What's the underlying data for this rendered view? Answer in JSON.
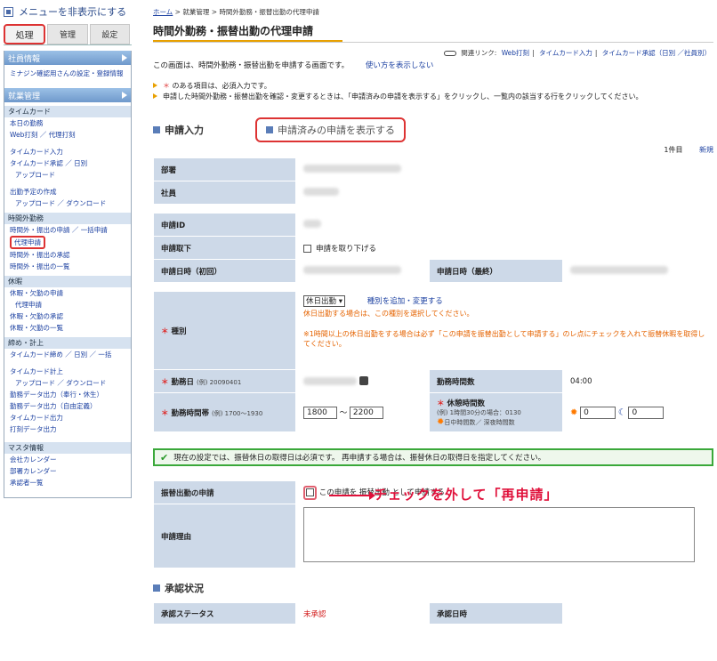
{
  "sidebar": {
    "hide_menu": "メニューを非表示にする",
    "tabs": [
      "処理",
      "管理",
      "設定"
    ],
    "sections": [
      {
        "title": "社員情報",
        "items": [
          "ミナジン確認用さんの設定・登録情報"
        ]
      },
      {
        "title": "就業管理"
      }
    ],
    "categories": {
      "timecard": "タイムカード",
      "overtime": "時間外勤務",
      "leave": "休暇",
      "close": "締め・計上",
      "master": "マスタ情報"
    },
    "timecard_items": [
      "本日の勤務",
      "Web打刻 ／ 代理打刻",
      "タイムカード入力",
      "タイムカード承認 ／ 日別",
      "アップロード",
      "出勤予定の作成",
      "アップロード ／ ダウンロード"
    ],
    "overtime_items": [
      "時間外・振出の申請 ／ 一括申請",
      "代理申請",
      "時間外・振出の承認",
      "時間外・振出の一覧"
    ],
    "leave_items": [
      "休暇・欠勤の申請",
      "代理申請",
      "休暇・欠勤の承認",
      "休暇・欠勤の一覧"
    ],
    "close_items": [
      "タイムカード締め ／ 日別 ／ 一括",
      "タイムカード計上",
      "アップロード ／ ダウンロード",
      "勤務データ出力（奉行・休生）",
      "勤務データ出力（自由定義）",
      "タイムカード出力",
      "打刻データ出力"
    ],
    "master_items": [
      "会社カレンダー",
      "部署カレンダー",
      "承認者一覧"
    ]
  },
  "breadcrumb": {
    "home": "ホーム",
    "sep": ">",
    "b2": "就業管理",
    "b3": "時間外勤務・振替出勤の代理申請"
  },
  "page_title": "時間外勤務・振替出勤の代理申請",
  "related": {
    "label": "関連リンク:",
    "links": [
      "Web打刻",
      "タイムカード入力",
      "タイムカード承認（日別 ／社員別）"
    ]
  },
  "description": "この画面は、時間外勤務・振替出勤を申請する画面です。",
  "how_to": "使い方を表示しない",
  "notes": [
    "のある項目は、必須入力です。",
    "申請した時間外勤務・振替出勤を確認・変更するときは、「申請済みの申請を表示する」をクリックし、一覧内の該当する行をクリックしてください。"
  ],
  "section_input": "申請入力",
  "show_submitted": "申請済みの申請を表示する",
  "count": "1件目",
  "new": "新規",
  "form": {
    "dept": "部署",
    "employee": "社員",
    "app_id": "申請ID",
    "withdraw": "申請取下",
    "withdraw_check": "申請を取り下げる",
    "date_first": "申請日時（初回）",
    "date_latest": "申請日時（最終）",
    "type": "種別",
    "type_value": "休日出勤",
    "type_link": "種別を追加・変更する",
    "type_note1": "休日出勤する場合は、この種別を選択してください。",
    "type_note2": "※1時間以上の休日出勤をする場合は必ず「この申請を振替出勤として申請する」のレ点にチェックを入れて振替休暇を取得してください。",
    "work_date": "勤務日",
    "work_date_ex": "(例) 20090401",
    "work_hours_label": "勤務時間数",
    "work_hours": "04:00",
    "work_time": "勤務時間帯",
    "work_time_ex": "(例) 1700～1930",
    "start": "1800",
    "tilde": "～",
    "end": "2200",
    "break_label": "休憩時間数",
    "break_ex": "(例) 1時間30分の場合：0130",
    "break_legend": "日中時間数／ 深夜時間数",
    "break_day": "0",
    "break_night": "0"
  },
  "banner": "現在の設定では、振替休日の取得日は必須です。 再申請する場合は、振替休日の取得日を指定してください。",
  "annotation": "チェックを外して「再申請」",
  "transfer": {
    "label": "振替出勤の申請",
    "text": "この申請を 振替出勤 として申請する"
  },
  "reason": "申請理由",
  "approval": {
    "title": "承認状況",
    "status_label": "承認ステータス",
    "status": "未承認",
    "date_label": "承認日時"
  }
}
